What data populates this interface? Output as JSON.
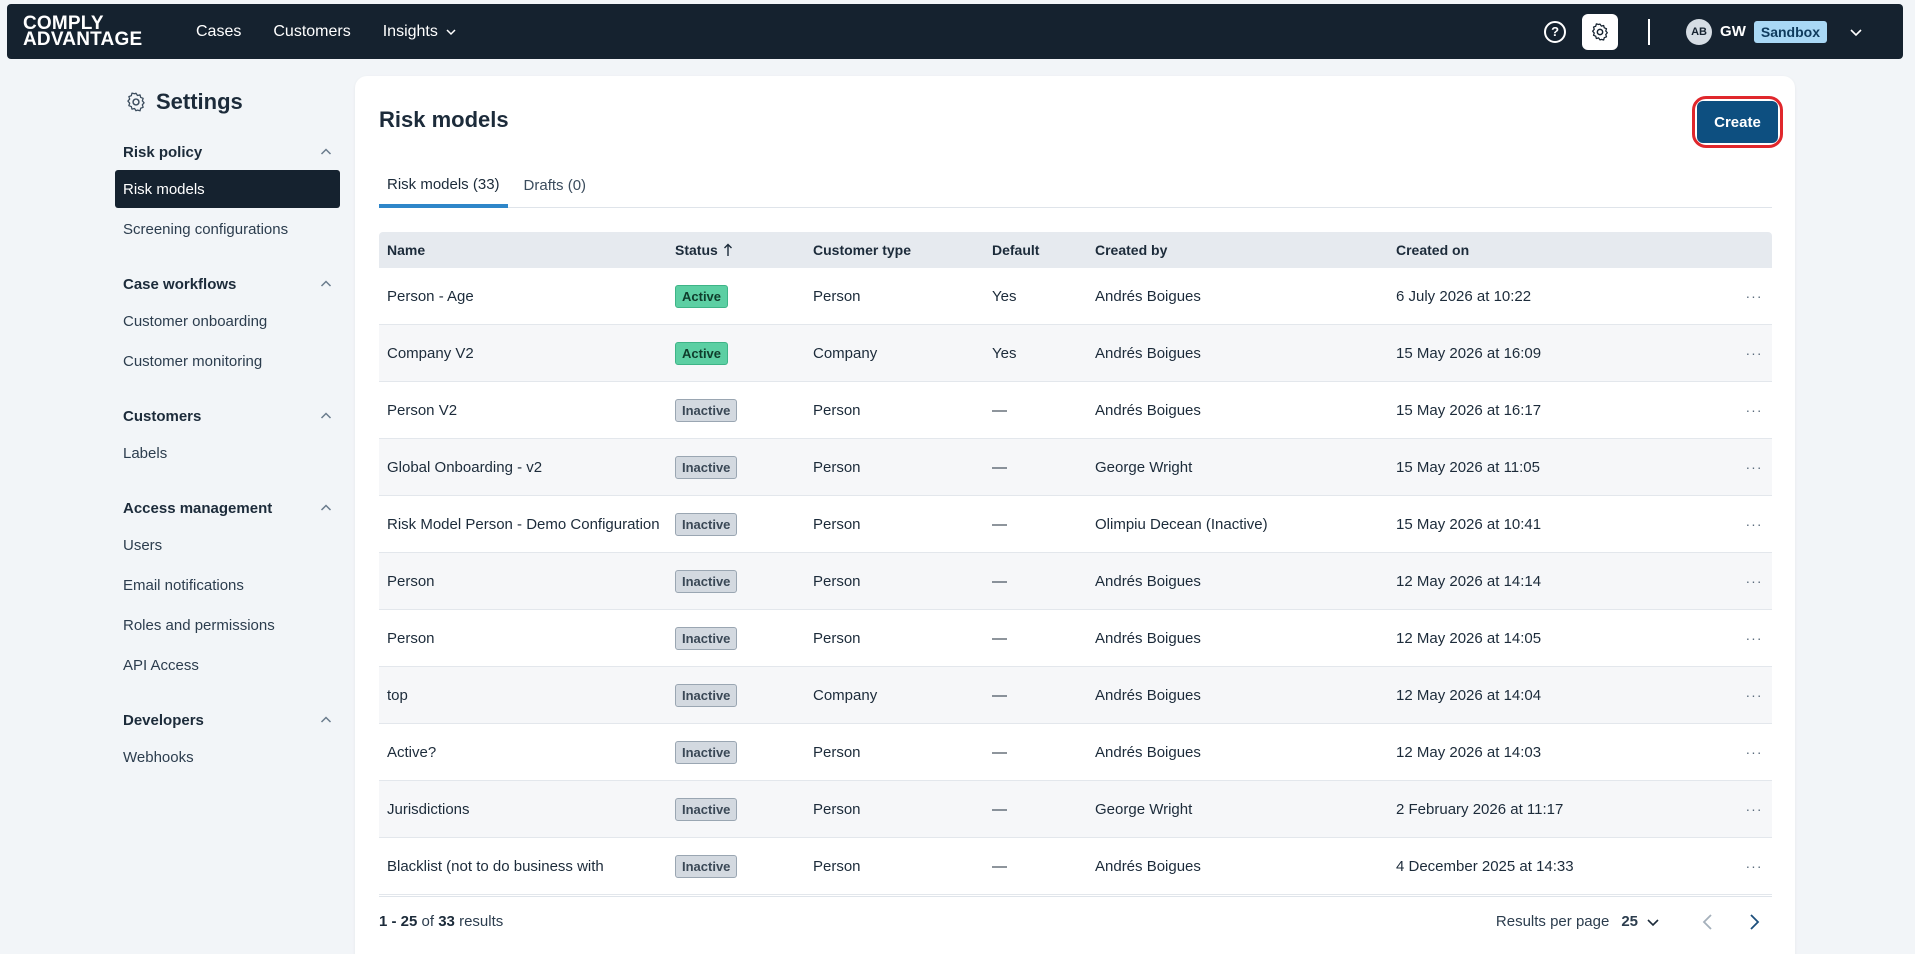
{
  "topnav": {
    "logo_line1": "COMPLY",
    "logo_line2": "ADVANTAGE",
    "links": [
      {
        "label": "Cases"
      },
      {
        "label": "Customers"
      },
      {
        "label": "Insights"
      }
    ],
    "avatar_initials": "AB",
    "user_initials": "GW",
    "env_badge": "Sandbox"
  },
  "sidebar": {
    "title": "Settings",
    "sections": [
      {
        "label": "Risk policy",
        "items": [
          "Risk models",
          "Screening configurations"
        ]
      },
      {
        "label": "Case workflows",
        "items": [
          "Customer onboarding",
          "Customer monitoring"
        ]
      },
      {
        "label": "Customers",
        "items": [
          "Labels"
        ]
      },
      {
        "label": "Access management",
        "items": [
          "Users",
          "Email notifications",
          "Roles and permissions",
          "API Access"
        ]
      },
      {
        "label": "Developers",
        "items": [
          "Webhooks"
        ]
      }
    ]
  },
  "main": {
    "title": "Risk models",
    "create_label": "Create",
    "tabs": [
      {
        "label": "Risk models (33)"
      },
      {
        "label": "Drafts (0)"
      }
    ],
    "table": {
      "headers": {
        "name": "Name",
        "status": "Status",
        "type": "Customer type",
        "default": "Default",
        "created_by": "Created by",
        "created_on": "Created on"
      },
      "rows": [
        {
          "name": "Person - Age",
          "status": "Active",
          "type": "Person",
          "default": "Yes",
          "created_by": "Andrés Boigues",
          "created_on": "6 July 2026 at 10:22"
        },
        {
          "name": "Company V2",
          "status": "Active",
          "type": "Company",
          "default": "Yes",
          "created_by": "Andrés Boigues",
          "created_on": "15 May 2026 at 16:09"
        },
        {
          "name": "Person V2",
          "status": "Inactive",
          "type": "Person",
          "default": "—",
          "created_by": "Andrés Boigues",
          "created_on": "15 May 2026 at 16:17"
        },
        {
          "name": "Global Onboarding - v2",
          "status": "Inactive",
          "type": "Person",
          "default": "—",
          "created_by": "George Wright",
          "created_on": "15 May 2026 at 11:05"
        },
        {
          "name": "Risk Model Person - Demo Configuration",
          "status": "Inactive",
          "type": "Person",
          "default": "—",
          "created_by": "Olimpiu Decean (Inactive)",
          "created_on": "15 May 2026 at 10:41"
        },
        {
          "name": "Person",
          "status": "Inactive",
          "type": "Person",
          "default": "—",
          "created_by": "Andrés Boigues",
          "created_on": "12 May 2026 at 14:14"
        },
        {
          "name": "Person",
          "status": "Inactive",
          "type": "Person",
          "default": "—",
          "created_by": "Andrés Boigues",
          "created_on": "12 May 2026 at 14:05"
        },
        {
          "name": "top",
          "status": "Inactive",
          "type": "Company",
          "default": "—",
          "created_by": "Andrés Boigues",
          "created_on": "12 May 2026 at 14:04"
        },
        {
          "name": "Active?",
          "status": "Inactive",
          "type": "Person",
          "default": "—",
          "created_by": "Andrés Boigues",
          "created_on": "12 May 2026 at 14:03"
        },
        {
          "name": "Jurisdictions",
          "status": "Inactive",
          "type": "Person",
          "default": "—",
          "created_by": "George Wright",
          "created_on": "2 February 2026 at 11:17"
        },
        {
          "name": "Blacklist (not to do business with",
          "status": "Inactive",
          "type": "Person",
          "default": "—",
          "created_by": "Andrés Boigues",
          "created_on": "4 December 2025 at 14:33"
        }
      ],
      "more_label": "···"
    },
    "footer": {
      "range": "1 - 25",
      "of": "of",
      "total": "33",
      "results": "results",
      "rpp_label": "Results per page",
      "rpp_value": "25"
    }
  }
}
